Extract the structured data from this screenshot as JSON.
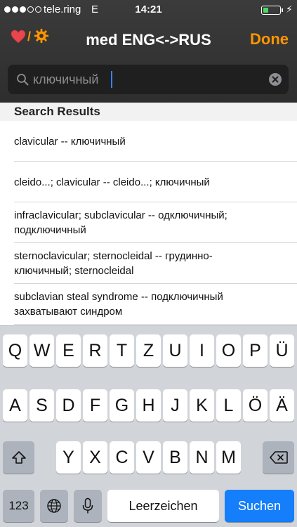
{
  "status": {
    "signal_bars": 3,
    "signal_max": 5,
    "carrier": "tele.ring",
    "network": "E",
    "time": "14:21",
    "battery_level": 0.3,
    "battery_color": "#4cd964"
  },
  "nav": {
    "title": "med ENG<->RUS",
    "done": "Done",
    "slash": "/",
    "accent_color": "#ff9500"
  },
  "search": {
    "value": "ключичный",
    "placeholder": ""
  },
  "results": {
    "header": "Search Results",
    "items": [
      {
        "line1": "clavicular -- ключичный",
        "line2": ""
      },
      {
        "line1": "cleido...; clavicular -- cleido...; ключичный",
        "line2": ""
      },
      {
        "line1": "infraclavicular; subclavicular -- одключичный;",
        "line2": "подключичный"
      },
      {
        "line1": "sternoclavicular; sternocleidal -- грудинно-",
        "line2": "ключичный; sternocleidal"
      },
      {
        "line1": "subclavian steal syndrome -- подключичный",
        "line2": "захватывают синдром"
      }
    ]
  },
  "keyboard": {
    "row1": [
      "Q",
      "W",
      "E",
      "R",
      "T",
      "Z",
      "U",
      "I",
      "O",
      "P",
      "Ü"
    ],
    "row2": [
      "A",
      "S",
      "D",
      "F",
      "G",
      "H",
      "J",
      "K",
      "L",
      "Ö",
      "Ä"
    ],
    "row3": [
      "Y",
      "X",
      "C",
      "V",
      "B",
      "N",
      "M"
    ],
    "numbers": "123",
    "space": "Leerzeichen",
    "search": "Suchen",
    "shift_icon": "shift-icon",
    "delete_icon": "delete-icon",
    "globe_icon": "globe-icon",
    "mic_icon": "microphone-icon",
    "search_key_color": "#147efb"
  }
}
